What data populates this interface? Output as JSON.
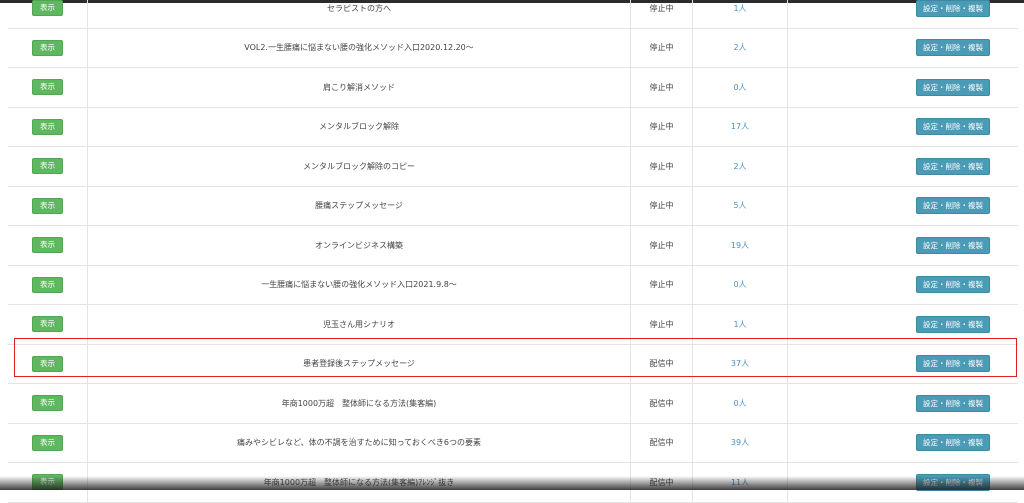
{
  "table": {
    "rows": [
      {
        "show_label": "表示",
        "title": "セラピストの方へ",
        "status": "停止中",
        "count": "1人",
        "action_label": "設定・削除・複製"
      },
      {
        "show_label": "表示",
        "title": "VOL2.一生腰痛に悩まない腰の強化メソッド入口2020.12.20～",
        "status": "停止中",
        "count": "2人",
        "action_label": "設定・削除・複製"
      },
      {
        "show_label": "表示",
        "title": "肩こり解消メソッド",
        "status": "停止中",
        "count": "0人",
        "action_label": "設定・削除・複製"
      },
      {
        "show_label": "表示",
        "title": "メンタルブロック解除",
        "status": "停止中",
        "count": "17人",
        "action_label": "設定・削除・複製"
      },
      {
        "show_label": "表示",
        "title": "メンタルブロック解除のコピー",
        "status": "停止中",
        "count": "2人",
        "action_label": "設定・削除・複製"
      },
      {
        "show_label": "表示",
        "title": "腰痛ステップメッセージ",
        "status": "停止中",
        "count": "5人",
        "action_label": "設定・削除・複製"
      },
      {
        "show_label": "表示",
        "title": "オンラインビジネス構築",
        "status": "停止中",
        "count": "19人",
        "action_label": "設定・削除・複製"
      },
      {
        "show_label": "表示",
        "title": "一生腰痛に悩まない腰の強化メソッド入口2021.9.8～",
        "status": "停止中",
        "count": "0人",
        "action_label": "設定・削除・複製"
      },
      {
        "show_label": "表示",
        "title": "児玉さん用シナリオ",
        "status": "停止中",
        "count": "1人",
        "action_label": "設定・削除・複製"
      },
      {
        "show_label": "表示",
        "title": "患者登録後ステップメッセージ",
        "status": "配信中",
        "count": "37人",
        "action_label": "設定・削除・複製"
      },
      {
        "show_label": "表示",
        "title": "年商1000万超　整体師になる方法(集客編)",
        "status": "配信中",
        "count": "0人",
        "action_label": "設定・削除・複製"
      },
      {
        "show_label": "表示",
        "title": "痛みやシビレなど、体の不調を治すために知っておくべき6つの要素",
        "status": "配信中",
        "count": "39人",
        "action_label": "設定・削除・複製"
      },
      {
        "show_label": "表示",
        "title": "年商1000万超　整体師になる方法(集客編)ｱﾚﾝｼﾞ抜き",
        "status": "配信中",
        "count": "11人",
        "action_label": "設定・削除・複製"
      }
    ]
  },
  "colors": {
    "show_button": "#5fb85f",
    "action_button": "#4b9bb6",
    "count_text": "#4a8fc2",
    "highlight_border": "#e02020"
  }
}
